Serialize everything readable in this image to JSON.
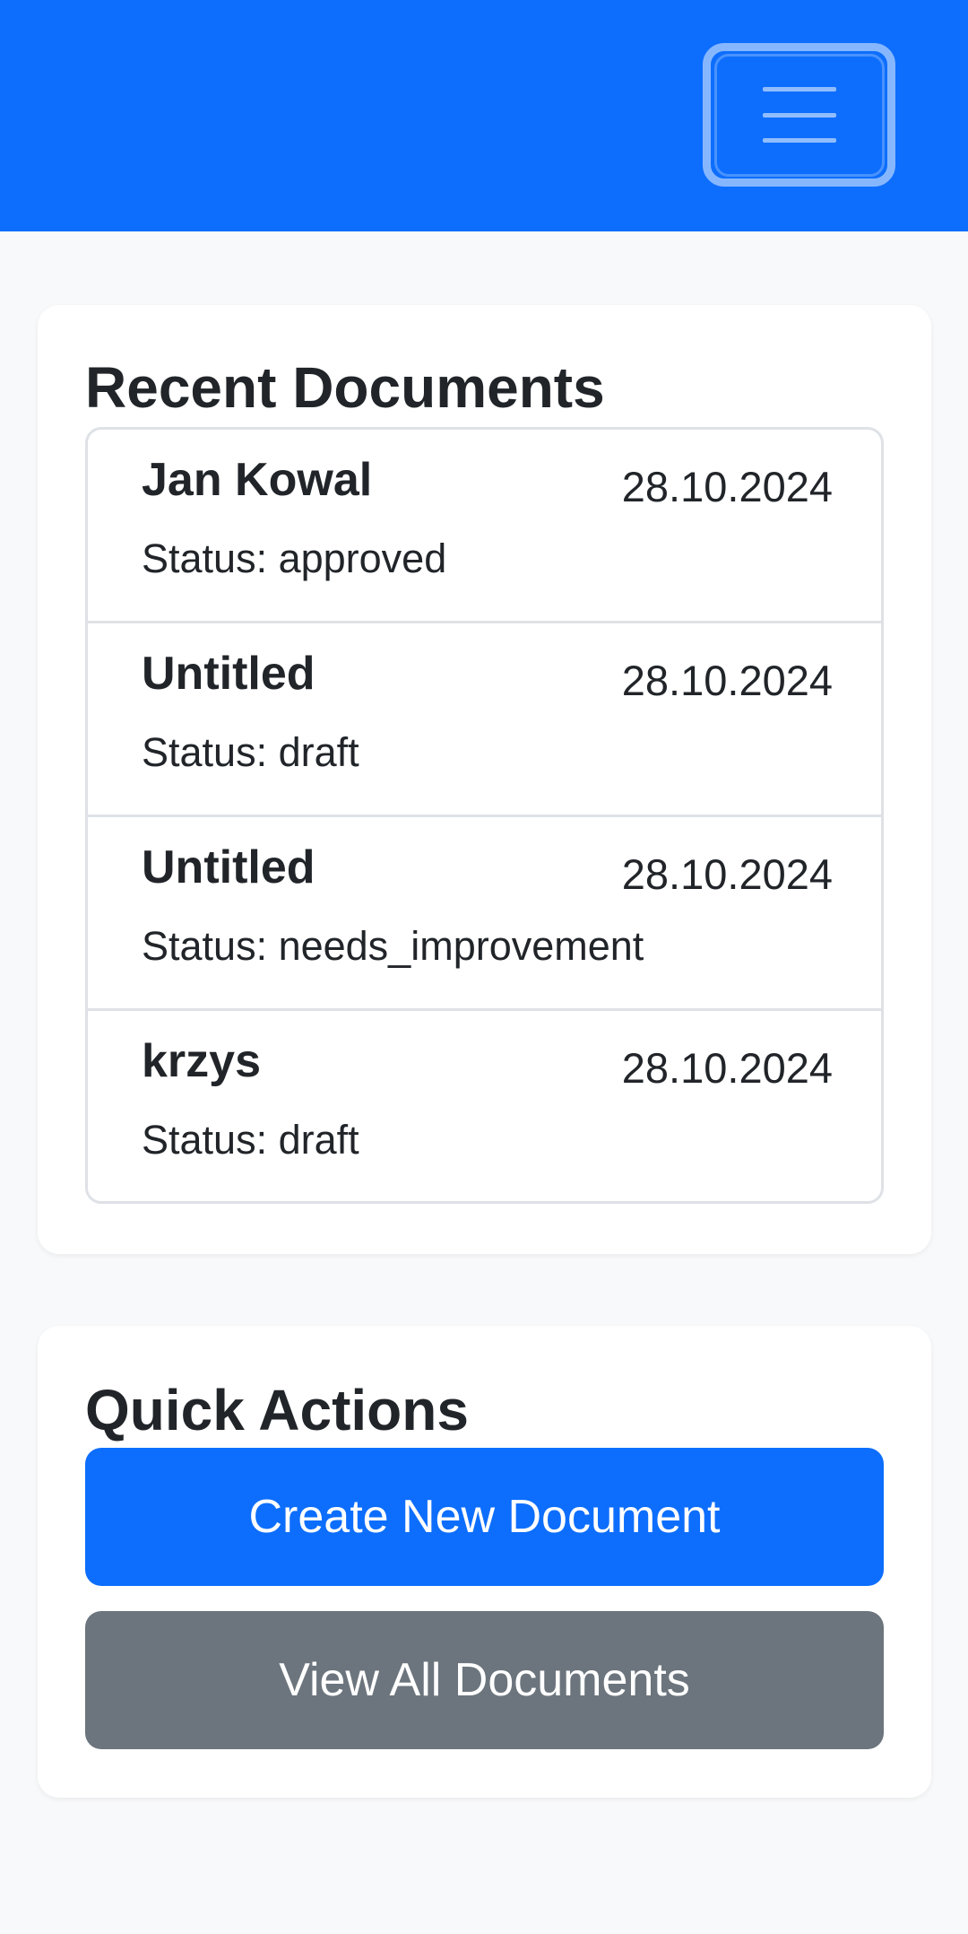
{
  "navbar": {
    "toggler_icon": "hamburger-menu-icon",
    "brand_color": "#0d6efd"
  },
  "recent_documents": {
    "title": "Recent Documents",
    "items": [
      {
        "name": "Jan Kowal",
        "date": "28.10.2024",
        "status": "Status: approved"
      },
      {
        "name": "Untitled",
        "date": "28.10.2024",
        "status": "Status: draft"
      },
      {
        "name": "Untitled",
        "date": "28.10.2024",
        "status": "Status: needs_improvement"
      },
      {
        "name": "krzys",
        "date": "28.10.2024",
        "status": "Status: draft"
      }
    ]
  },
  "quick_actions": {
    "title": "Quick Actions",
    "create_label": "Create New Document",
    "view_all_label": "View All Documents"
  },
  "colors": {
    "primary": "#0d6efd",
    "secondary": "#6c757d",
    "background": "#f8f9fa"
  }
}
